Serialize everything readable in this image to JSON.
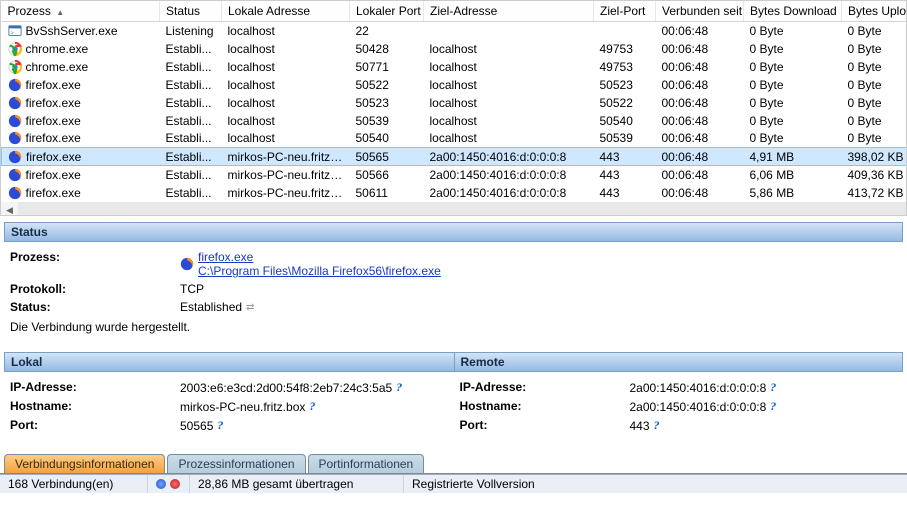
{
  "headers": {
    "process": "Prozess",
    "status": "Status",
    "local_addr": "Lokale Adresse",
    "local_port": "Lokaler Port",
    "remote_addr": "Ziel-Adresse",
    "remote_port": "Ziel-Port",
    "connected_since": "Verbunden seit",
    "bytes_down": "Bytes Download",
    "bytes_up": "Bytes Upload"
  },
  "rows": [
    {
      "icon": "term",
      "process": "BvSshServer.exe",
      "status": "Listening",
      "laddr": "localhost",
      "lport": "22",
      "raddr": "",
      "rport": "",
      "since": "00:06:48",
      "down": "0 Byte",
      "up": "0 Byte",
      "sel": false
    },
    {
      "icon": "chrome",
      "process": "chrome.exe",
      "status": "Establi...",
      "laddr": "localhost",
      "lport": "50428",
      "raddr": "localhost",
      "rport": "49753",
      "since": "00:06:48",
      "down": "0 Byte",
      "up": "0 Byte",
      "sel": false
    },
    {
      "icon": "chrome",
      "process": "chrome.exe",
      "status": "Establi...",
      "laddr": "localhost",
      "lport": "50771",
      "raddr": "localhost",
      "rport": "49753",
      "since": "00:06:48",
      "down": "0 Byte",
      "up": "0 Byte",
      "sel": false
    },
    {
      "icon": "ff",
      "process": "firefox.exe",
      "status": "Establi...",
      "laddr": "localhost",
      "lport": "50522",
      "raddr": "localhost",
      "rport": "50523",
      "since": "00:06:48",
      "down": "0 Byte",
      "up": "0 Byte",
      "sel": false
    },
    {
      "icon": "ff",
      "process": "firefox.exe",
      "status": "Establi...",
      "laddr": "localhost",
      "lport": "50523",
      "raddr": "localhost",
      "rport": "50522",
      "since": "00:06:48",
      "down": "0 Byte",
      "up": "0 Byte",
      "sel": false
    },
    {
      "icon": "ff",
      "process": "firefox.exe",
      "status": "Establi...",
      "laddr": "localhost",
      "lport": "50539",
      "raddr": "localhost",
      "rport": "50540",
      "since": "00:06:48",
      "down": "0 Byte",
      "up": "0 Byte",
      "sel": false
    },
    {
      "icon": "ff",
      "process": "firefox.exe",
      "status": "Establi...",
      "laddr": "localhost",
      "lport": "50540",
      "raddr": "localhost",
      "rport": "50539",
      "since": "00:06:48",
      "down": "0 Byte",
      "up": "0 Byte",
      "sel": false
    },
    {
      "icon": "ff",
      "process": "firefox.exe",
      "status": "Establi...",
      "laddr": "mirkos-PC-neu.fritz.box",
      "lport": "50565",
      "raddr": "2a00:1450:4016:d:0:0:0:8",
      "rport": "443",
      "since": "00:06:48",
      "down": "4,91 MB",
      "up": "398,02 KB",
      "sel": true
    },
    {
      "icon": "ff",
      "process": "firefox.exe",
      "status": "Establi...",
      "laddr": "mirkos-PC-neu.fritz.box",
      "lport": "50566",
      "raddr": "2a00:1450:4016:d:0:0:0:8",
      "rport": "443",
      "since": "00:06:48",
      "down": "6,06 MB",
      "up": "409,36 KB",
      "sel": false
    },
    {
      "icon": "ff",
      "process": "firefox.exe",
      "status": "Establi...",
      "laddr": "mirkos-PC-neu.fritz.box",
      "lport": "50611",
      "raddr": "2a00:1450:4016:d:0:0:0:8",
      "rport": "443",
      "since": "00:06:48",
      "down": "5,86 MB",
      "up": "413,72 KB",
      "sel": false
    }
  ],
  "status_panel": {
    "title": "Status",
    "process_label": "Prozess:",
    "process_name": "firefox.exe",
    "process_path": "C:\\Program Files\\Mozilla Firefox56\\firefox.exe",
    "protocol_label": "Protokoll:",
    "protocol_value": "TCP",
    "status_label": "Status:",
    "status_value": "Established",
    "message": "Die Verbindung wurde hergestellt."
  },
  "lokal": {
    "title": "Lokal",
    "ip_label": "IP-Adresse:",
    "ip_value": "2003:e6:e3cd:2d00:54f8:2eb7:24c3:5a5",
    "host_label": "Hostname:",
    "host_value": "mirkos-PC-neu.fritz.box",
    "port_label": "Port:",
    "port_value": "50565"
  },
  "remote": {
    "title": "Remote",
    "ip_label": "IP-Adresse:",
    "ip_value": "2a00:1450:4016:d:0:0:0:8",
    "host_label": "Hostname:",
    "host_value": "2a00:1450:4016:d:0:0:0:8",
    "port_label": "Port:",
    "port_value": "443"
  },
  "tabs": {
    "t1": "Verbindungsinformationen",
    "t2": "Prozessinformationen",
    "t3": "Portinformationen"
  },
  "statusbar": {
    "connections": "168 Verbindung(en)",
    "transferred": "28,86 MB gesamt übertragen",
    "license": "Registrierte Vollversion"
  }
}
